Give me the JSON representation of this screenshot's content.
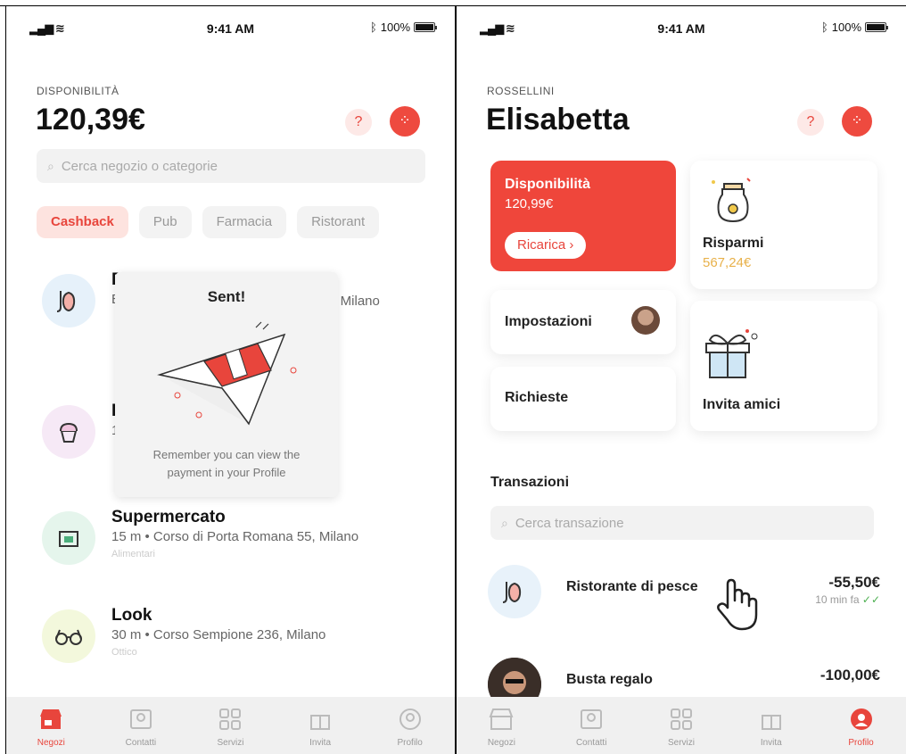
{
  "left_screen": {
    "status": {
      "time": "9:41 AM",
      "battery": "100%"
    },
    "eyebrow": "DISPONIBILITÀ",
    "balance": "120,39€",
    "help_label": "?",
    "search": {
      "placeholder": "Cerca negozio o categorie"
    },
    "chips": [
      "Cashback",
      "Pub",
      "Farmacia",
      "Ristorant"
    ],
    "stores": [
      {
        "name": "R",
        "addr": "E",
        "category": "",
        "icon": "fish-icon"
      },
      {
        "name": "L",
        "addr": "1",
        "category": "",
        "icon": "cupcake-icon"
      },
      {
        "name": "Supermercato",
        "addr": "15 m • Corso di Porta Romana 55, Milano",
        "category": "Alimentari",
        "icon": "grocery-icon"
      },
      {
        "name": "Look",
        "addr": "30 m • Corso Sempione 236, Milano",
        "category": "Ottico",
        "icon": "glasses-icon"
      }
    ],
    "store_addr_fragment": "5, Milano",
    "toast": {
      "title": "Sent!",
      "message": "Remember you can view the payment in your Profile",
      "icon": "paper-plane-icon"
    },
    "tabs": [
      {
        "label": "Negozi",
        "icon": "store-icon",
        "active": true
      },
      {
        "label": "Contatti",
        "icon": "contacts-icon",
        "active": false
      },
      {
        "label": "Servizi",
        "icon": "services-icon",
        "active": false
      },
      {
        "label": "Invita",
        "icon": "gift-icon",
        "active": false
      },
      {
        "label": "Profilo",
        "icon": "profile-icon",
        "active": false
      }
    ]
  },
  "right_screen": {
    "status": {
      "time": "9:41 AM",
      "battery": "100%"
    },
    "surname": "ROSSELLINI",
    "first_name": "Elisabetta",
    "help_label": "?",
    "availability": {
      "label": "Disponibilità",
      "value": "120,99€",
      "topup": "Ricarica ›"
    },
    "savings": {
      "label": "Risparmi",
      "value": "567,24€"
    },
    "settings_label": "Impostazioni",
    "requests_label": "Richieste",
    "invite_label": "Invita amici",
    "transactions_title": "Transazioni",
    "search": {
      "placeholder": "Cerca transazione"
    },
    "transactions": [
      {
        "name": "Ristorante di pesce",
        "amount": "-55,50€",
        "time": "10 min fa",
        "icon": "fish-icon"
      },
      {
        "name": "Busta regalo",
        "amount": "-100,00€",
        "time": "",
        "sub": "",
        "icon": "avatar"
      }
    ],
    "tabs": [
      {
        "label": "Negozi",
        "icon": "store-icon",
        "active": false
      },
      {
        "label": "Contatti",
        "icon": "contacts-icon",
        "active": false
      },
      {
        "label": "Servizi",
        "icon": "services-icon",
        "active": false
      },
      {
        "label": "Invita",
        "icon": "gift-icon",
        "active": false
      },
      {
        "label": "Profilo",
        "icon": "profile-icon",
        "active": true
      }
    ]
  },
  "colors": {
    "accent": "#ef463b",
    "savings": "#e8b14a",
    "read_ticks": "#4caf50"
  }
}
